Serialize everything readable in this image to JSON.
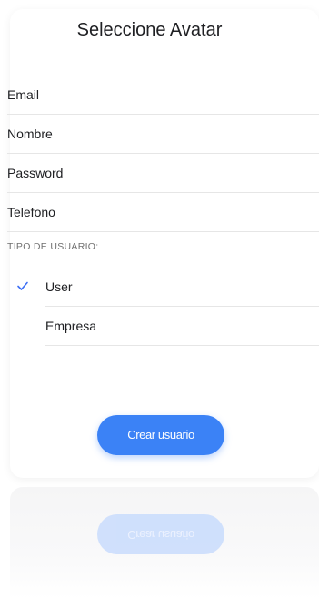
{
  "header": {
    "title": "Seleccione Avatar"
  },
  "form": {
    "fields": [
      {
        "placeholder": "Email"
      },
      {
        "placeholder": "Nombre"
      },
      {
        "placeholder": "Password"
      },
      {
        "placeholder": "Telefono"
      }
    ],
    "user_type_label": "TIPO DE USUARIO:",
    "user_type_options": [
      {
        "label": "User",
        "selected": true
      },
      {
        "label": "Empresa",
        "selected": false
      }
    ],
    "submit_label": "Crear usuario"
  },
  "colors": {
    "accent": "#3b82f6",
    "check": "#3b6ef5"
  },
  "icons": {
    "check": "check-icon"
  }
}
